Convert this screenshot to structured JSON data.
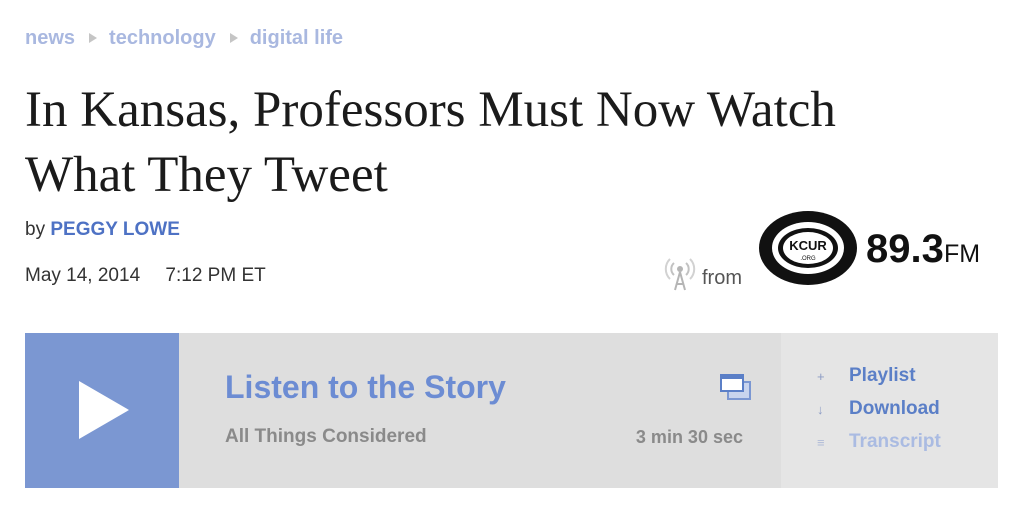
{
  "breadcrumb": {
    "items": [
      "news",
      "technology",
      "digital life"
    ]
  },
  "article": {
    "headline": "In Kansas, Professors Must Now Watch What They Tweet",
    "byline_prefix": "by",
    "author": "PEGGY LOWE",
    "date": "May 14, 2014",
    "time": "7:12 PM ET"
  },
  "station": {
    "from_label": "from",
    "logo_text": "KCUR",
    "logo_subtext": ".ORG",
    "frequency": "89.3",
    "band": "FM"
  },
  "player": {
    "title": "Listen to the Story",
    "program": "All Things Considered",
    "duration": "3 min 30 sec",
    "links": [
      {
        "glyph": "+",
        "label": "Playlist"
      },
      {
        "glyph": "↓",
        "label": "Download"
      },
      {
        "glyph": "≡",
        "label": "Transcript"
      }
    ]
  },
  "colors": {
    "accent": "#4e72c4",
    "play_button": "#7b97d2",
    "breadcrumb": "#a9b8e0",
    "player_bg": "#dedede"
  },
  "icons": {
    "play": "play-icon",
    "popout": "popout-window-icon",
    "radio": "radio-tower-icon"
  }
}
